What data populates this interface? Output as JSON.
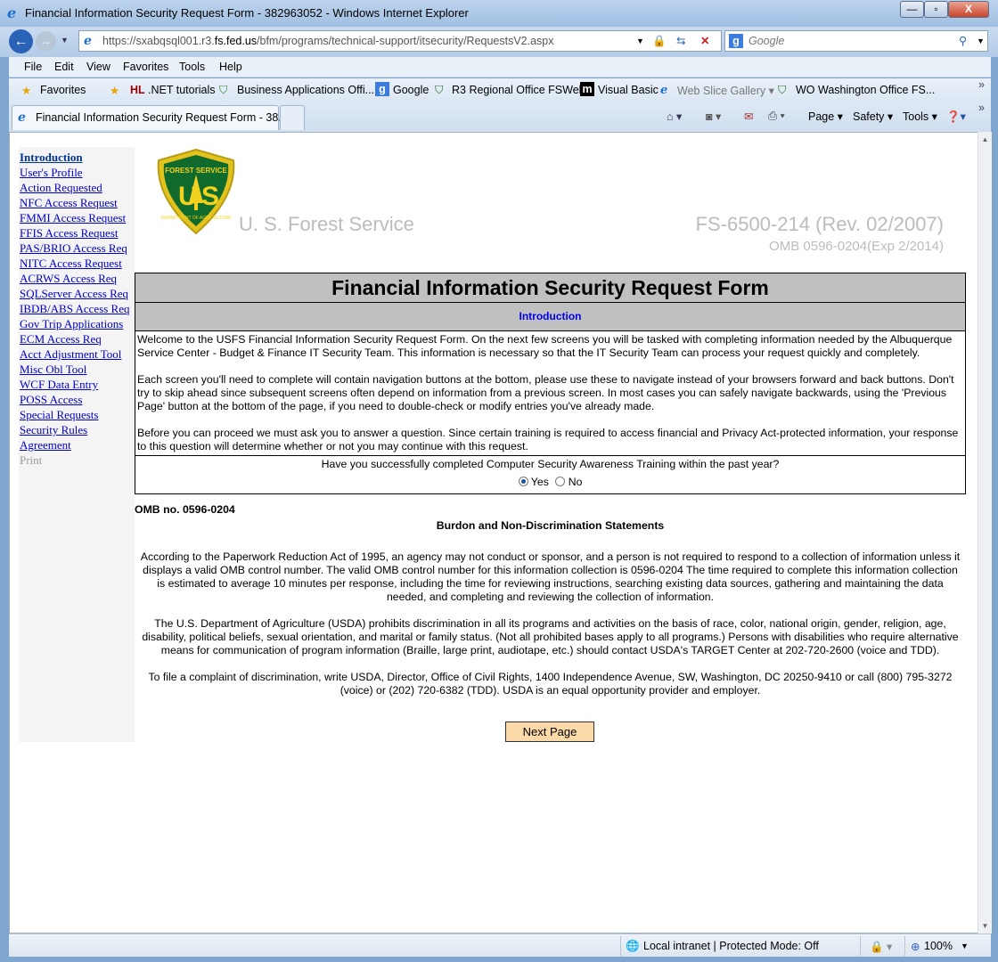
{
  "window": {
    "title": "Financial Information Security Request Form - 382963052 - Windows Internet Explorer",
    "minimize": "—",
    "maximize": "▫",
    "close": "X"
  },
  "address": {
    "prefix": "https://sxabqsql001.r3.",
    "host": "fs.fed.us",
    "path": "/bfm/programs/technical-support/itsecurity/RequestsV2.aspx"
  },
  "search": {
    "placeholder": "Google"
  },
  "menu": [
    "File",
    "Edit",
    "View",
    "Favorites",
    "Tools",
    "Help"
  ],
  "favorites": {
    "label": "Favorites",
    "items": [
      ".NET tutorials",
      "Business Applications Offi...",
      "Google",
      "R3 Regional Office FSWeb",
      "Visual Basic",
      "Web Slice Gallery ▾",
      "WO Washington Office FS..."
    ]
  },
  "tab": {
    "label": "Financial Information Security Request Form - 38..."
  },
  "commandbar": {
    "page": "Page ▾",
    "safety": "Safety ▾",
    "tools": "Tools ▾"
  },
  "sidebar": {
    "items": [
      "Introduction",
      "User's Profile",
      "Action Requested",
      "NFC Access Request",
      "FMMI Access Request",
      "FFIS Access Request",
      "PAS/BRIO Access Req",
      "NITC Access Request",
      "ACRWS Access Req",
      "SQLServer Access Req",
      "IBDB/ABS Access Req",
      "Gov Trip Applications",
      "ECM Access Req",
      "Acct Adjustment Tool",
      "Misc Obl Tool",
      "WCF Data Entry",
      "POSS Access",
      "Special Requests",
      "Security Rules",
      "Agreement"
    ],
    "disabled": "Print"
  },
  "header": {
    "logo_text": "FOREST SERVICE · US · DEPARTMENT OF AGRICULTURE",
    "agency": "U. S. Forest Service",
    "form_no": "FS-6500-214 (Rev. 02/2007)",
    "omb": "OMB 0596-0204(Exp 2/2014)"
  },
  "form": {
    "title": "Financial Information Security Request Form",
    "section": "Introduction",
    "p1": "Welcome to the USFS Financial Information Security Request Form. On the next few screens you will be tasked with completing information needed by the Albuquerque Service Center - Budget & Finance IT Security Team. This information is necessary so that the IT Security Team can process your request quickly and completely.",
    "p2": "Each screen you'll need to complete will contain navigation buttons at the bottom, please use these to navigate instead of your browsers forward and back buttons. Don't try to skip ahead since subsequent screens often depend on information from a previous screen. In most cases you can safely navigate backwards, using the 'Previous Page' button at the bottom of the page, if you need to double-check or modify entries you've already made.",
    "p3": "Before you can proceed we must ask you to answer a question. Since certain training is required to access financial and Privacy Act-protected information, your response to this question will determine whether or not you may continue with this request.",
    "question": "Have you successfully completed Computer Security Awareness Training within the past year?",
    "yes": "Yes",
    "no": "No",
    "selected": "Yes"
  },
  "statements": {
    "omb": "OMB no. 0596-0204",
    "heading": "Burdon and Non-Discrimination Statements",
    "p1": "According to the Paperwork Reduction Act of 1995, an agency may not conduct or sponsor, and a person is not required to respond to a collection of information unless it displays a valid OMB control number. The valid OMB control number for this information collection is 0596-0204 The time required to complete this information collection is estimated to average 10 minutes per response, including the time for reviewing instructions, searching existing data sources, gathering and maintaining the data needed, and completing and reviewing the collection of information.",
    "p2": "The U.S. Department of Agriculture (USDA) prohibits discrimination in all its programs and activities on the basis of race, color, national origin, gender, religion, age, disability, political beliefs, sexual orientation, and marital or family status. (Not all prohibited bases apply to all programs.) Persons with disabilities who require alternative means for communication of program information (Braille, large print, audiotape, etc.) should contact USDA's TARGET Center at 202-720-2600 (voice and TDD).",
    "p3": "To file a complaint of discrimination, write USDA, Director, Office of Civil Rights, 1400 Independence Avenue, SW, Washington, DC 20250-9410 or call (800) 795-3272 (voice) or (202) 720-6382 (TDD). USDA is an equal opportunity provider and employer."
  },
  "next_button": "Next Page",
  "status": {
    "zone": "Local intranet | Protected Mode: Off",
    "zoom": "100%"
  }
}
